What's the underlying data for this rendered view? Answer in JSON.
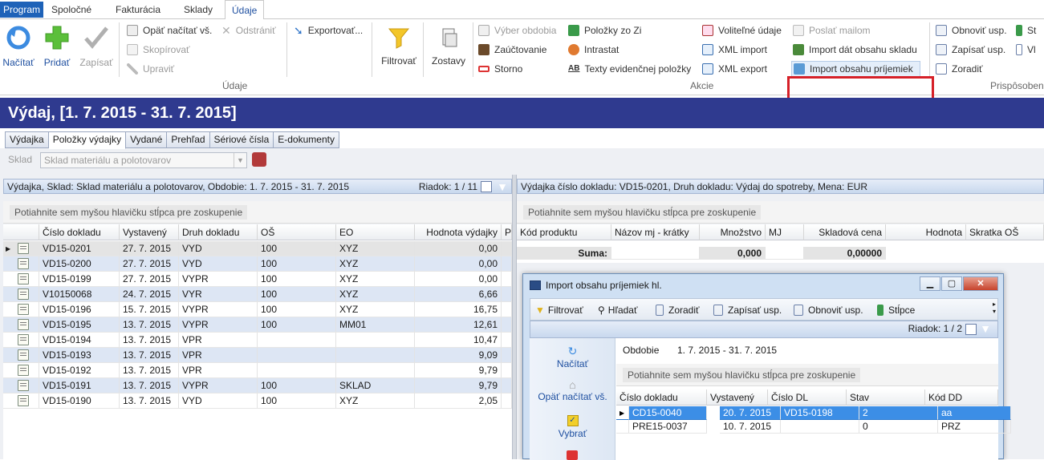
{
  "menu": {
    "tabs": [
      "Program",
      "Spoločné",
      "Fakturácia",
      "Sklady",
      "Údaje"
    ]
  },
  "ribbon": {
    "big_buttons": {
      "load": "Načítať",
      "add": "Pridať",
      "save": "Zapísať",
      "filter": "Filtrovať",
      "reports": "Zostavy"
    },
    "data_group": {
      "reload_all": "Opäť načítať vš.",
      "delete": "Odstrániť",
      "copy": "Skopírovať",
      "edit": "Upraviť",
      "export": "Exportovať...",
      "label": "Údaje"
    },
    "actions_group": {
      "period": "Výber obdobia",
      "post": "Zaúčtovanie",
      "storno": "Storno",
      "items_from": "Položky zo Zi",
      "intrastat": "Intrastat",
      "texts": "Texty evidenčnej položky",
      "optional": "Voliteľné údaje",
      "xml_import": "XML import",
      "xml_export": "XML export",
      "send_mail": "Poslať mailom",
      "import_stock": "Import dát obsahu skladu",
      "import_receipts": "Import obsahu príjemiek",
      "label": "Akcie"
    },
    "custom_group": {
      "refresh_settings": "Obnoviť usp.",
      "save_settings": "Zapísať usp.",
      "sort": "Zoradiť",
      "label": "Prispôsobeni",
      "cut1": "St",
      "cut2": "Vl"
    }
  },
  "title": "Výdaj,  [1. 7. 2015 - 31. 7. 2015]",
  "tabs": [
    "Výdajka",
    "Položky výdajky",
    "Vydané",
    "Prehľad",
    "Sériové čísla",
    "E-dokumenty"
  ],
  "active_tab_index": 1,
  "filter": {
    "label": "Sklad",
    "value": "Sklad materiálu a polotovarov"
  },
  "left_grid": {
    "info": "Výdajka, Sklad: Sklad materiálu a polotovarov, Obdobie: 1. 7. 2015 - 31. 7. 2015",
    "row_counter": "Riadok: 1 / 11",
    "group_hint": "Potiahnite sem myšou hlavičku stĺpca pre zoskupenie",
    "columns": [
      "Číslo dokladu",
      "Vystavený",
      "Druh dokladu",
      "OŠ",
      "EO",
      "Hodnota výdajky",
      "P"
    ],
    "rows": [
      [
        "VD15-0201",
        "27. 7. 2015",
        "VYD",
        "100",
        "XYZ",
        "0,00"
      ],
      [
        "VD15-0200",
        "27. 7. 2015",
        "VYD",
        "100",
        "XYZ",
        "0,00"
      ],
      [
        "VD15-0199",
        "27. 7. 2015",
        "VYPR",
        "100",
        "XYZ",
        "0,00"
      ],
      [
        "V10150068",
        "24. 7. 2015",
        "VYR",
        "100",
        "XYZ",
        "6,66"
      ],
      [
        "VD15-0196",
        "15. 7. 2015",
        "VYPR",
        "100",
        "XYZ",
        "16,75"
      ],
      [
        "VD15-0195",
        "13. 7. 2015",
        "VYPR",
        "100",
        "MM01",
        "12,61"
      ],
      [
        "VD15-0194",
        "13. 7. 2015",
        "VPR",
        "",
        "",
        "10,47"
      ],
      [
        "VD15-0193",
        "13. 7. 2015",
        "VPR",
        "",
        "",
        "9,09"
      ],
      [
        "VD15-0192",
        "13. 7. 2015",
        "VPR",
        "",
        "",
        "9,79"
      ],
      [
        "VD15-0191",
        "13. 7. 2015",
        "VYPR",
        "100",
        "SKLAD",
        "9,79"
      ],
      [
        "VD15-0190",
        "13. 7. 2015",
        "VYD",
        "100",
        "XYZ",
        "2,05"
      ]
    ]
  },
  "right_grid": {
    "info": "Výdajka číslo dokladu: VD15-0201, Druh dokladu: Výdaj do spotreby, Mena: EUR",
    "group_hint": "Potiahnite sem myšou hlavičku stĺpca pre zoskupenie",
    "columns": [
      "Kód produktu",
      "Názov mj - krátky",
      "Množstvo",
      "MJ",
      "Skladová cena",
      "Hodnota",
      "Skratka OŠ"
    ],
    "sum_label": "Suma:",
    "sum_qty": "0,000",
    "sum_price": "0,00000"
  },
  "popup": {
    "title": "Import obsahu príjemiek hl.",
    "toolbar": [
      "Filtrovať",
      "Hľadať",
      "Zoradiť",
      "Zapísať usp.",
      "Obnoviť usp.",
      "Stĺpce"
    ],
    "row_counter": "Riadok: 1 / 2",
    "left_buttons": [
      "Načítať",
      "Opäť načítať vš.",
      "Vybrať"
    ],
    "period_label": "Obdobie",
    "period_value": "1. 7. 2015 - 31. 7. 2015",
    "group_hint": "Potiahnite sem myšou hlavičku stĺpca pre zoskupenie",
    "columns": [
      "Číslo dokladu",
      "Vystavený",
      "Číslo DL",
      "Stav",
      "Kód DD"
    ],
    "rows": [
      [
        "CD15-0040",
        "20. 7. 2015",
        "VD15-0198",
        "2",
        "aa"
      ],
      [
        "PRE15-0037",
        "10. 7. 2015",
        "",
        "0",
        "PRZ"
      ]
    ]
  },
  "colors": {
    "title_bg": "#2f3a8f",
    "accent": "#1e62b8",
    "highlight": "#d62028",
    "selection": "#3c8ee6"
  }
}
